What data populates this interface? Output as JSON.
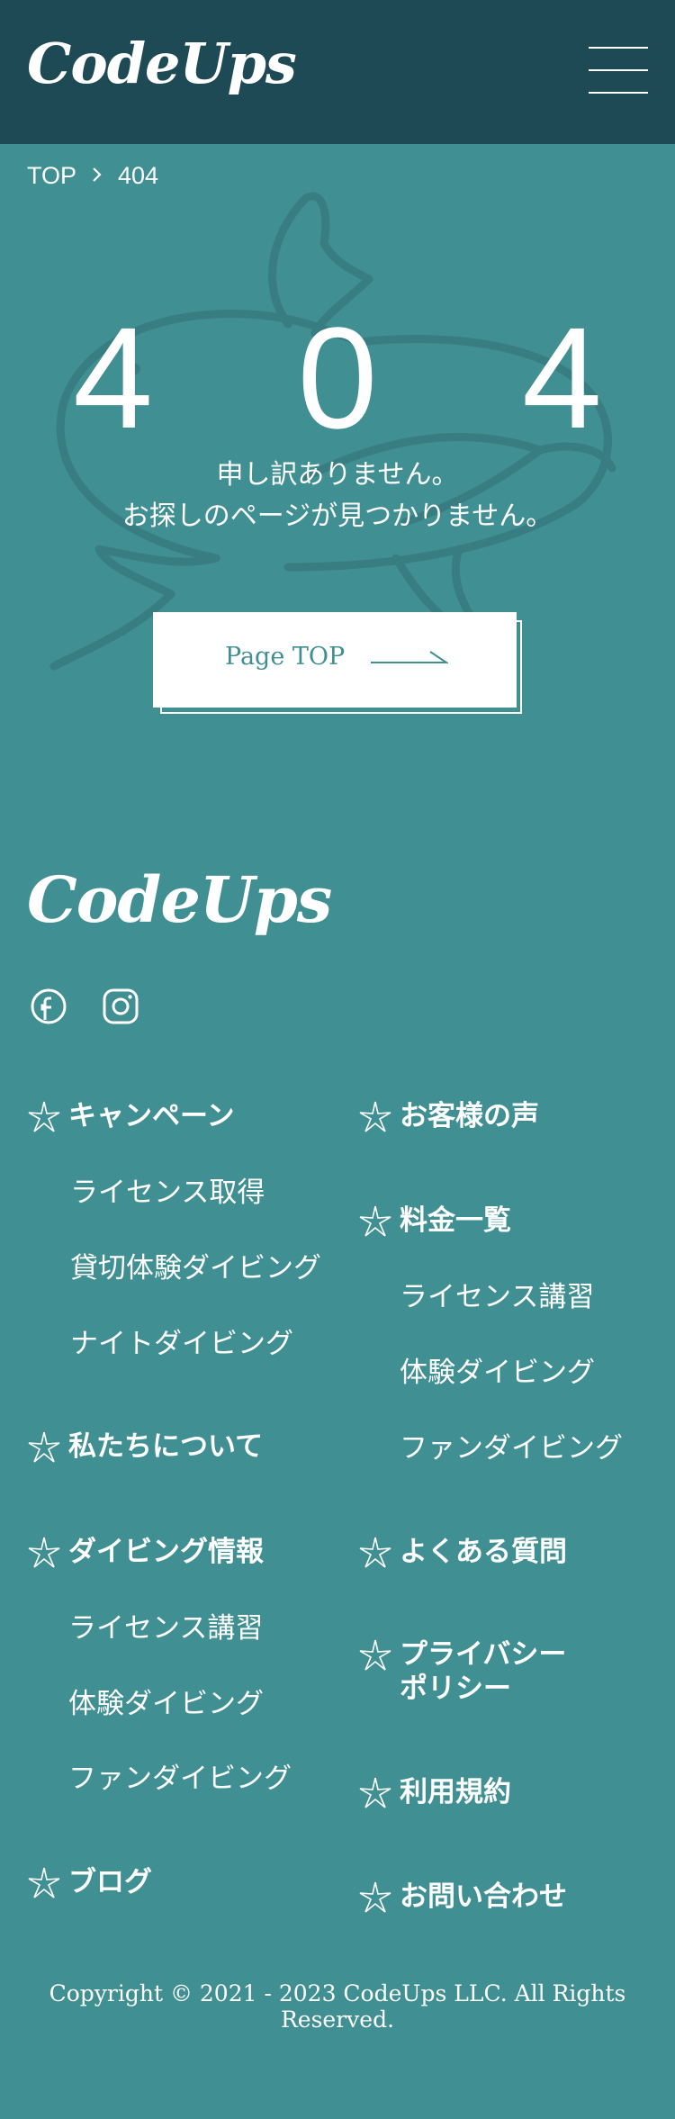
{
  "header": {
    "logo": "CodeUps"
  },
  "breadcrumb": {
    "home": "TOP",
    "current": "404"
  },
  "error": {
    "code": "4 0 4",
    "message_line1": "申し訳ありません。",
    "message_line2": "お探しのページが見つかりません。"
  },
  "page_top_button": {
    "label": "Page TOP"
  },
  "footer": {
    "logo": "CodeUps",
    "nav_left": [
      {
        "title": "キャンペーン",
        "items": [
          "ライセンス取得",
          "貸切体験ダイビング",
          "ナイトダイビング"
        ]
      },
      {
        "title": "私たちについて",
        "items": []
      },
      {
        "title": "ダイビング情報",
        "items": [
          "ライセンス講習",
          "体験ダイビング",
          "ファンダイビング"
        ]
      },
      {
        "title": "ブログ",
        "items": []
      }
    ],
    "nav_right": [
      {
        "title": "お客様の声",
        "items": []
      },
      {
        "title": "料金一覧",
        "items": [
          "ライセンス講習",
          "体験ダイビング",
          "ファンダイビング"
        ]
      },
      {
        "title": "よくある質問",
        "items": []
      },
      {
        "title": "プライバシー",
        "title2": "ポリシー",
        "items": []
      },
      {
        "title": "利用規約",
        "items": []
      },
      {
        "title": "お問い合わせ",
        "items": []
      }
    ],
    "copyright": "Copyright © 2021 - 2023 CodeUps LLC. All Rights Reserved."
  },
  "icons": [
    "hamburger-menu-icon",
    "chevron-right-icon",
    "facebook-icon",
    "instagram-icon",
    "starfish-icon",
    "arrow-right-icon"
  ],
  "colors": {
    "header_bg": "#1E4A55",
    "page_bg": "#408F93",
    "button_bg": "#FFFFFF",
    "accent": "#408F93"
  }
}
